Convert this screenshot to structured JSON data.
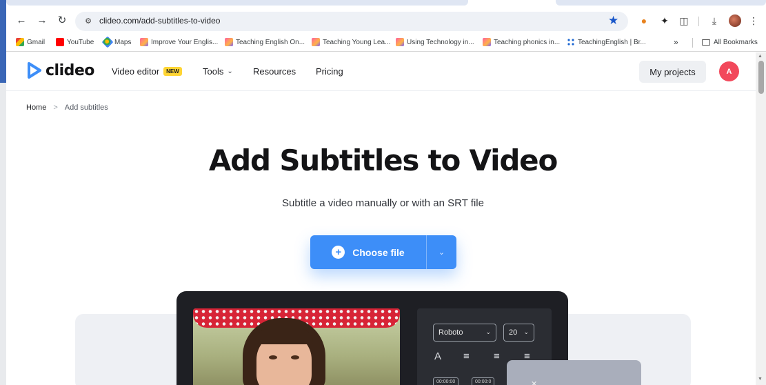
{
  "browser": {
    "url": "clideo.com/add-subtitles-to-video",
    "bookmarks": [
      {
        "label": "Gmail",
        "icon": "gmail-icon"
      },
      {
        "label": "YouTube",
        "icon": "youtube-icon"
      },
      {
        "label": "Maps",
        "icon": "maps-icon"
      },
      {
        "label": "Improve Your Englis...",
        "icon": "teachingenglish-icon"
      },
      {
        "label": "Teaching English On...",
        "icon": "teachingenglish-icon"
      },
      {
        "label": "Teaching Young Lea...",
        "icon": "teachingenglish-icon"
      },
      {
        "label": "Using Technology in...",
        "icon": "teachingenglish-icon"
      },
      {
        "label": "Teaching phonics in...",
        "icon": "teachingenglish-icon"
      },
      {
        "label": "TeachingEnglish | Br...",
        "icon": "teachingenglish-br-icon"
      }
    ],
    "overflow_label": "»",
    "all_bookmarks_label": "All Bookmarks"
  },
  "site": {
    "brand": "clideo",
    "brand_color": "#3d8ef8",
    "nav": {
      "video_editor": "Video editor",
      "new_badge": "NEW",
      "tools": "Tools",
      "resources": "Resources",
      "pricing": "Pricing"
    },
    "my_projects": "My projects",
    "user_initial": "A",
    "avatar_color": "#f2485b"
  },
  "breadcrumb": {
    "home": "Home",
    "separator": ">",
    "current": "Add subtitles"
  },
  "hero": {
    "title": "Add Subtitles to Video",
    "subtitle": "Subtitle a video manually or with an SRT file",
    "choose_file": "Choose file"
  },
  "preview": {
    "font_select": "Roboto",
    "size_select": "20",
    "text_icon": "A",
    "time_start": "00:00:00",
    "time_end": "00:00:0"
  }
}
